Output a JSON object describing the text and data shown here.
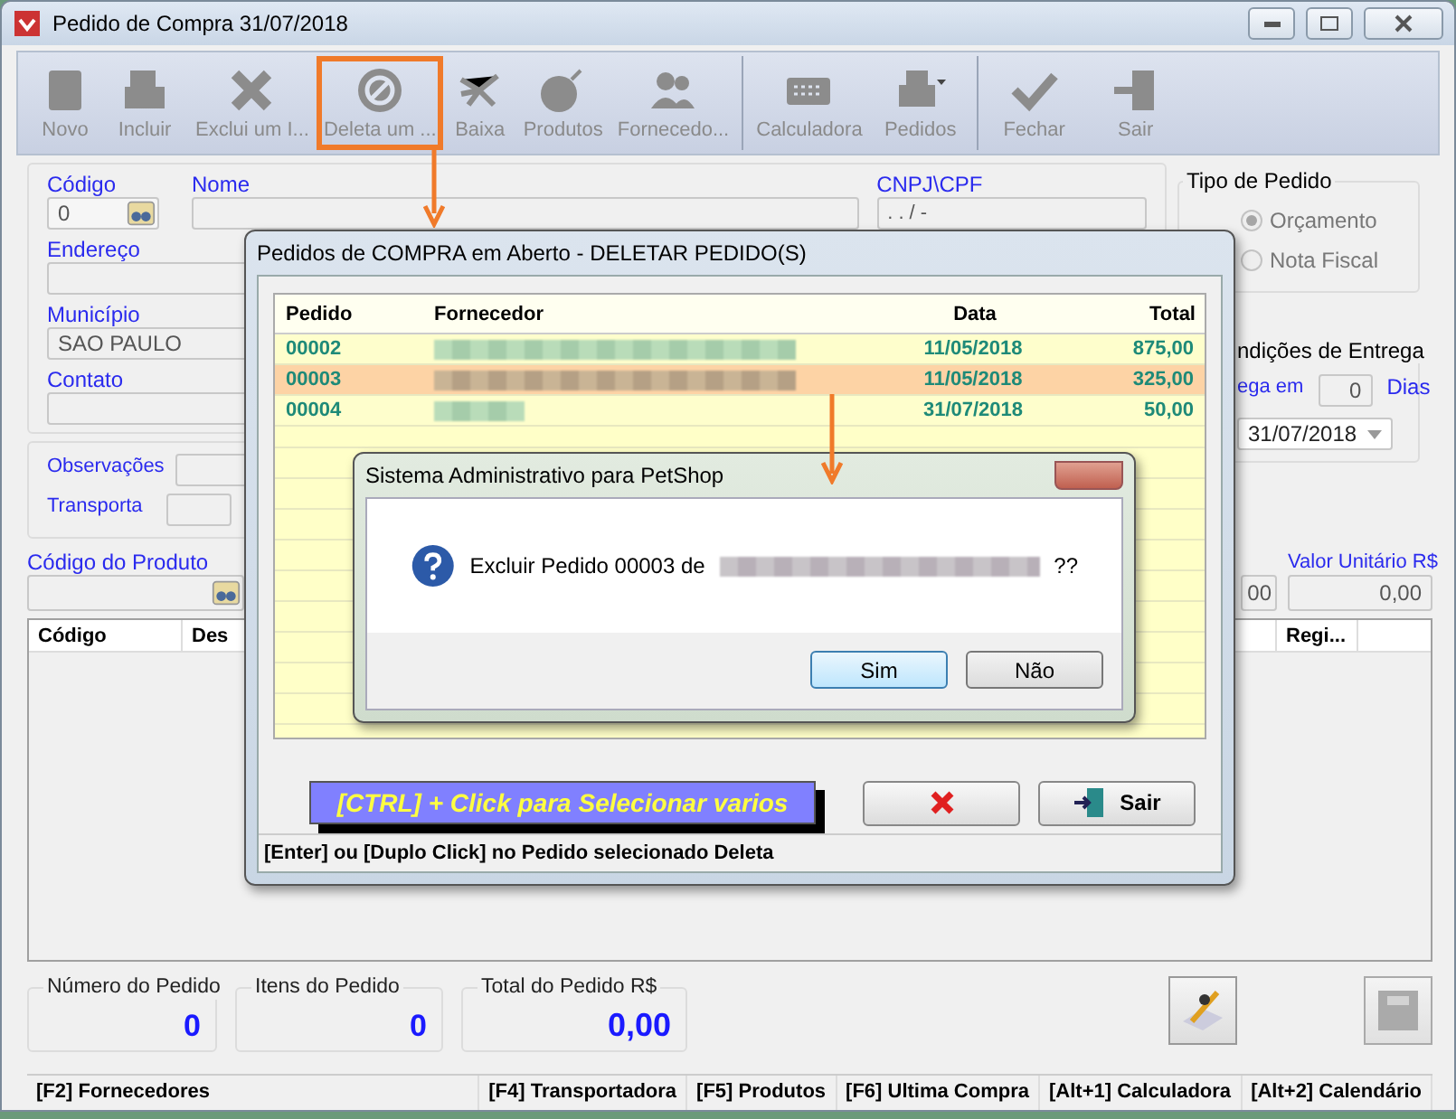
{
  "window": {
    "title": "Pedido de Compra 31/07/2018"
  },
  "toolbar": {
    "groups": [
      {
        "items": [
          {
            "label": "Novo",
            "kind": "notebook",
            "disabled": true,
            "highlighted": false
          },
          {
            "label": "Incluir",
            "kind": "printer",
            "disabled": true,
            "highlighted": false
          },
          {
            "label": "Exclui um I...",
            "kind": "cross",
            "disabled": true,
            "highlighted": false
          },
          {
            "label": "Deleta um ...",
            "kind": "ban",
            "disabled": true,
            "highlighted": true
          },
          {
            "label": "Baixa",
            "kind": "network",
            "disabled": true,
            "highlighted": false
          },
          {
            "label": "Produtos",
            "kind": "bomb",
            "disabled": true,
            "highlighted": false
          },
          {
            "label": "Fornecedo...",
            "kind": "people",
            "disabled": true,
            "highlighted": false
          }
        ]
      },
      {
        "items": [
          {
            "label": "Calculadora",
            "kind": "calculator",
            "disabled": true,
            "highlighted": false
          },
          {
            "label": "Pedidos",
            "kind": "printmenu",
            "disabled": true,
            "highlighted": false
          }
        ]
      },
      {
        "items": [
          {
            "label": "Fechar",
            "kind": "check",
            "disabled": true,
            "highlighted": false
          },
          {
            "label": "Sair",
            "kind": "exit",
            "disabled": true,
            "highlighted": false
          }
        ]
      }
    ]
  },
  "form": {
    "codigo": {
      "label": "Código",
      "value": "0"
    },
    "nome": {
      "label": "Nome"
    },
    "cnpj": {
      "label": "CNPJ\\CPF",
      "value": ". . / -"
    },
    "endereco": {
      "label": "Endereço"
    },
    "municipio": {
      "label": "Município",
      "value": "SAO PAULO"
    },
    "contato": {
      "label": "Contato"
    },
    "observacoes": {
      "label": "Observações"
    },
    "transporta": {
      "label": "Transporta"
    }
  },
  "tipo_pedido": {
    "title": "Tipo de Pedido",
    "disabled": true,
    "options": [
      {
        "label": "Orçamento",
        "selected": true
      },
      {
        "label": "Nota Fiscal",
        "selected": false
      }
    ]
  },
  "entrega": {
    "title": "ndições de Entrega",
    "prazo_label": "ega em",
    "prazo_value": "0",
    "unit": "Dias",
    "date": "31/07/2018"
  },
  "produto": {
    "codigo_label": "Código do Produto",
    "column_2_value": "00",
    "valor_label": "Valor Unitário R$",
    "valor_value": "0,00"
  },
  "items_table": {
    "columns": [
      "Código",
      "Des",
      "Regi..."
    ]
  },
  "totals": [
    {
      "label": "Número do Pedido",
      "value": "0"
    },
    {
      "label": "Itens do Pedido",
      "value": "0"
    },
    {
      "label": "Total do Pedido R$",
      "value": "0,00"
    }
  ],
  "status_bar": [
    "[F2] Fornecedores",
    "[F4] Transportadora",
    "[F5] Produtos",
    "[F6] Ultima Compra",
    "[Alt+1] Calculadora",
    "[Alt+2] Calendário"
  ],
  "orders_dialog": {
    "title": "Pedidos de COMPRA em Aberto - DELETAR PEDIDO(S)",
    "columns": [
      "Pedido",
      "Fornecedor",
      "Data",
      "Total"
    ],
    "rows": [
      {
        "pedido": "00002",
        "data": "11/05/2018",
        "total": "875,00",
        "selected": false
      },
      {
        "pedido": "00003",
        "data": "11/05/2018",
        "total": "325,00",
        "selected": true
      },
      {
        "pedido": "00004",
        "data": "31/07/2018",
        "total": "50,00",
        "selected": false
      }
    ],
    "hint": "[CTRL] + Click para Selecionar varios",
    "exit_label": "Sair",
    "status": "[Enter] ou [Duplo Click] no Pedido selecionado Deleta"
  },
  "confirm_dialog": {
    "title": "Sistema Administrativo para PetShop",
    "message": "Excluir Pedido 00003 de",
    "message_end": "??",
    "buttons": [
      {
        "label": "Sim",
        "default": true
      },
      {
        "label": "Não",
        "default": false
      }
    ]
  }
}
